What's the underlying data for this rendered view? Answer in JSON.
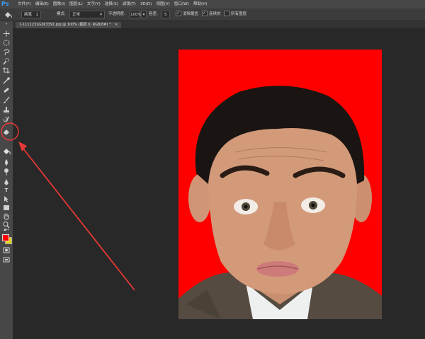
{
  "app": {
    "logo": "Ps"
  },
  "menu": [
    "文件(F)",
    "编辑(E)",
    "图像(I)",
    "图层(L)",
    "文字(Y)",
    "选择(S)",
    "滤镜(T)",
    "3D(D)",
    "视图(V)",
    "窗口(W)",
    "帮助(H)"
  ],
  "options": {
    "preset_label": "画笔",
    "preset_value": "1",
    "mode_label": "模式:",
    "mode_value": "正常",
    "opacity_label": "不透明度:",
    "opacity_value": "100%",
    "tolerance_label": "容差:",
    "tolerance_value": "5",
    "antialias_label": "消除锯齿",
    "antialias_checked": true,
    "contiguous_label": "连续的",
    "contiguous_checked": true,
    "all_layers_label": "所有图层",
    "all_layers_checked": false
  },
  "document": {
    "tab_title": "1-1111231G2K3391.jpg @ 100% (图层 0, RGB/8#) *"
  },
  "colors": {
    "foreground": "#ff0000",
    "background": "#e8d300",
    "canvas_background": "#ff0000",
    "annotation": "#e53935"
  },
  "tools": [
    "move-tool",
    "marquee-tool",
    "lasso-tool",
    "quick-select-tool",
    "crop-tool",
    "eyedropper-tool",
    "healing-brush-tool",
    "brush-tool",
    "clone-stamp-tool",
    "history-brush-tool",
    "eraser-tool",
    "paint-bucket-tool",
    "blur-tool",
    "dodge-tool",
    "pen-tool",
    "type-tool",
    "path-select-tool",
    "rectangle-tool",
    "hand-tool",
    "zoom-tool"
  ],
  "annotation": {
    "highlighted_tool": "paint-bucket-tool"
  }
}
